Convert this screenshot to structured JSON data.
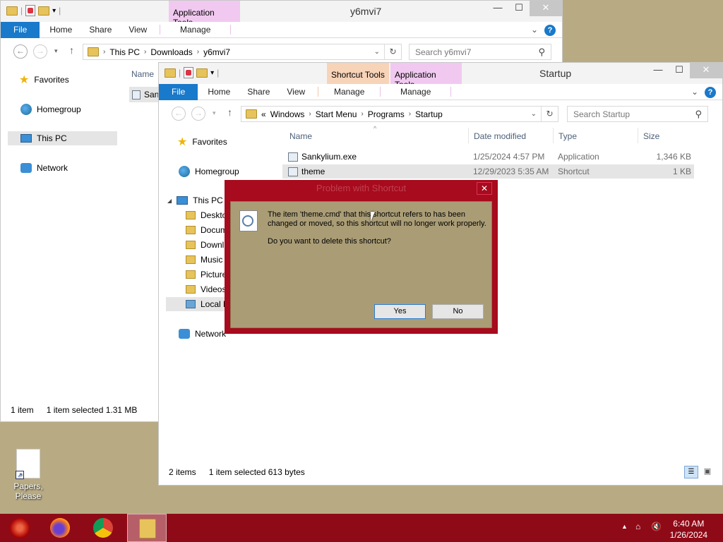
{
  "window_back": {
    "title": "y6mvi7",
    "context_tab": "Application Tools",
    "tabs": [
      "File",
      "Home",
      "Share",
      "View",
      "Manage"
    ],
    "path": [
      "This PC",
      "Downloads",
      "y6mvi7"
    ],
    "search_placeholder": "Search y6mvi7",
    "nav": [
      "Favorites",
      "Homegroup",
      "This PC",
      "Network"
    ],
    "col_name": "Name",
    "partial_file": "San",
    "status_items": "1 item",
    "status_selected": "1 item selected  1.31 MB"
  },
  "window_front": {
    "title": "Startup",
    "context_tab_1": "Shortcut Tools",
    "context_tab_2": "Application Tools",
    "tabs": [
      "File",
      "Home",
      "Share",
      "View",
      "Manage",
      "Manage"
    ],
    "path_prefix": "«",
    "path": [
      "Windows",
      "Start Menu",
      "Programs",
      "Startup"
    ],
    "search_placeholder": "Search Startup",
    "nav": {
      "favorites": "Favorites",
      "homegroup": "Homegroup",
      "thispc": "This PC",
      "sub": [
        "Deskto",
        "Docum",
        "Downl",
        "Music",
        "Picture",
        "Videos",
        "Local D"
      ],
      "network": "Network"
    },
    "columns": [
      "Name",
      "Date modified",
      "Type",
      "Size"
    ],
    "files": [
      {
        "name": "Sankylium.exe",
        "date": "1/25/2024 4:57 PM",
        "type": "Application",
        "size": "1,346 KB"
      },
      {
        "name": "theme",
        "date": "12/29/2023 5:35 AM",
        "type": "Shortcut",
        "size": "1 KB"
      }
    ],
    "status_items": "2 items",
    "status_selected": "1 item selected  613 bytes"
  },
  "dialog": {
    "title": "Problem with Shortcut",
    "message": "The item 'theme.cmd' that this shortcut refers to has been changed or moved, so this shortcut will no longer work properly.",
    "question": "Do you want to delete this shortcut?",
    "yes": "Yes",
    "no": "No",
    "close": "✕"
  },
  "desktop": {
    "icon_label": "Papers, Please"
  },
  "taskbar": {
    "time": "6:40 AM",
    "date": "1/26/2024"
  },
  "colors": {
    "accent": "#1979ca",
    "taskbar": "#8f0a17",
    "dialog_frame": "#a70b1d",
    "desktop": "#b8ab84"
  }
}
